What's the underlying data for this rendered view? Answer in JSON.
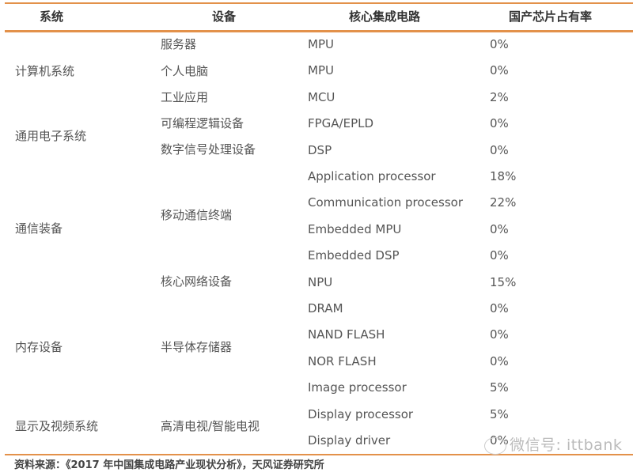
{
  "table": {
    "headers": [
      "系统",
      "设备",
      "核心集成电路",
      "国产芯片占有率"
    ],
    "systems": [
      {
        "label": "计算机系统"
      },
      {
        "label": "通用电子系统"
      },
      {
        "label": "通信装备"
      },
      {
        "label": "内存设备"
      },
      {
        "label": "显示及视频系统"
      }
    ],
    "devices": [
      {
        "label": "服务器"
      },
      {
        "label": "个人电脑"
      },
      {
        "label": "工业应用"
      },
      {
        "label": "可编程逻辑设备"
      },
      {
        "label": "数字信号处理设备"
      },
      {
        "label": "移动通信终端"
      },
      {
        "label": "核心网络设备"
      },
      {
        "label": "半导体存储器"
      },
      {
        "label": "高清电视/智能电视"
      }
    ],
    "rows": [
      {
        "ic": "MPU",
        "share": "0%"
      },
      {
        "ic": "MPU",
        "share": "0%"
      },
      {
        "ic": "MCU",
        "share": "2%"
      },
      {
        "ic": "FPGA/EPLD",
        "share": "0%"
      },
      {
        "ic": "DSP",
        "share": "0%"
      },
      {
        "ic": "Application processor",
        "share": "18%"
      },
      {
        "ic": "Communication processor",
        "share": "22%"
      },
      {
        "ic": "Embedded MPU",
        "share": "0%"
      },
      {
        "ic": "Embedded DSP",
        "share": "0%"
      },
      {
        "ic": "NPU",
        "share": "15%"
      },
      {
        "ic": "DRAM",
        "share": "0%"
      },
      {
        "ic": "NAND FLASH",
        "share": "0%"
      },
      {
        "ic": "NOR FLASH",
        "share": "0%"
      },
      {
        "ic": "Image processor",
        "share": "5%"
      },
      {
        "ic": "Display processor",
        "share": "5%"
      },
      {
        "ic": "Display driver",
        "share": "0%"
      }
    ]
  },
  "source": "资料来源：《2017 年中国集成电路产业现状分析》，天风证券研究所",
  "watermark": "微信号: ittbank",
  "colors": {
    "rule": "#e3914a"
  }
}
